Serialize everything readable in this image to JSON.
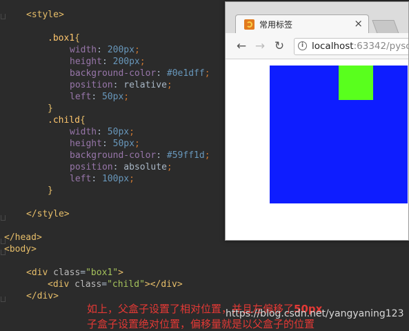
{
  "editor": {
    "lines": {
      "style_open": "<style>",
      "box1_selector": ".box1",
      "child_selector": ".child",
      "style_close": "</style>",
      "head_close": "</head>",
      "body_open": "<body>",
      "div_close": "</div>"
    },
    "props": {
      "width": "width",
      "height": "height",
      "bgcolor": "background-color",
      "position": "position",
      "left": "left"
    },
    "values": {
      "box1_width": "200",
      "box1_height": "200",
      "box1_bg": "#0e1dff",
      "box1_position": "relative",
      "box1_left": "50",
      "child_width": "50",
      "child_height": "50",
      "child_bg": "#59ff1d",
      "child_position": "absolute",
      "child_left": "100",
      "unit": "px"
    },
    "html": {
      "div": "div",
      "class": "class",
      "box1_class": "\"box1\"",
      "child_class": "\"child\""
    }
  },
  "browser": {
    "tab_title": "常用标签",
    "tab_close": "×",
    "back": "←",
    "forward": "→",
    "reload": "↻",
    "info": "i",
    "url_host": "localhost",
    "url_rest": ":63342/pysc",
    "box1_color": "#0e1dff",
    "child_color": "#59ff1d"
  },
  "annotations": {
    "note1_text": "如上，父盒子设置了相对位置，并且左偏移了",
    "note1_bold": "50px",
    "note2_text": "子盒子设置绝对位置，偏移量就是以父盒子的位置"
  },
  "watermark": "https://blog.csdn.net/yangyaning123"
}
